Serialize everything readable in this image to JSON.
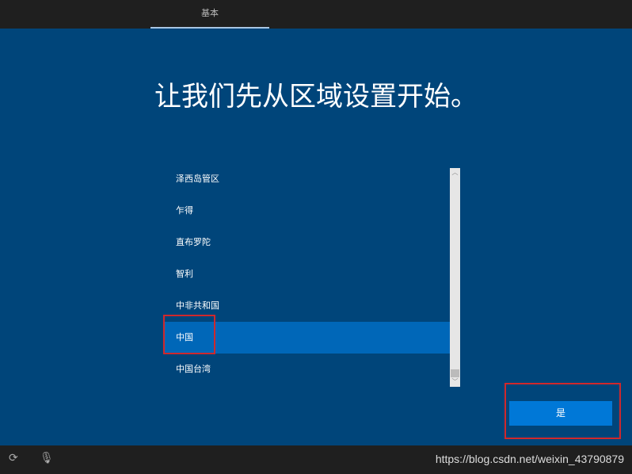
{
  "header": {
    "tab": "基本"
  },
  "main": {
    "title": "让我们先从区域设置开始。",
    "regions": [
      "泽西岛管区",
      "乍得",
      "直布罗陀",
      "智利",
      "中非共和国",
      "中国",
      "中国台湾"
    ],
    "selected": "中国",
    "yes_button": "是"
  },
  "footer": {
    "icons": [
      "ease-of-access-icon",
      "microphone-icon"
    ],
    "watermark": "https://blog.csdn.net/weixin_43790879"
  },
  "colors": {
    "background": "#00457a",
    "selected": "#0067b8",
    "button": "#0078d7",
    "highlight": "#d0282c"
  }
}
